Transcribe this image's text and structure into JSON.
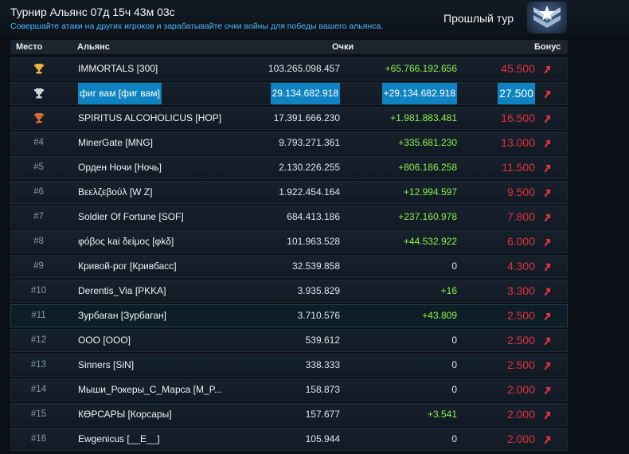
{
  "header": {
    "title": "Турнир Альянс 07д 15ч 43м 03с",
    "subtitle": "Совершайте атаки на других игроков и зарабатывайте очки войны для победы вашего альянса.",
    "prev_round": "Прошлый тур",
    "emblem_icon": "alliance-rank-emblem-icon"
  },
  "columns": {
    "place": "Место",
    "alliance": "Альянс",
    "points": "Очки",
    "bonus": "Бонус"
  },
  "colors": {
    "accent_blue": "#4fb7ff",
    "gain_green": "#8ef24c",
    "bonus_red": "#e0323f",
    "selection": "#0f83c1"
  },
  "rows": [
    {
      "rank": "",
      "trophy": "gold",
      "name": "IMMORTALS [300]",
      "score": "103.265.098.457",
      "gain": "+65.766.192.656",
      "bonus": "45.500"
    },
    {
      "rank": "",
      "trophy": "silver",
      "name": "фиг вам [фиг вам]",
      "score": "29.134.682.918",
      "gain": "+29.134.682.918",
      "bonus": "27.500",
      "selected": true
    },
    {
      "rank": "",
      "trophy": "bronze",
      "name": "SPIRITUS ALCOHOLICUS [НОР]",
      "score": "17.391.666.230",
      "gain": "+1.981.883.481",
      "bonus": "16.500"
    },
    {
      "rank": "#4",
      "name": "MinerGate [MNG]",
      "score": "9.793.271.361",
      "gain": "+335.681.230",
      "bonus": "13.000"
    },
    {
      "rank": "#5",
      "name": "Орден Ночи [Ночь]",
      "score": "2.130.226.255",
      "gain": "+806.186.258",
      "bonus": "11.500"
    },
    {
      "rank": "#6",
      "name": "Βεελζεβούλ [W Z]",
      "score": "1.922.454.164",
      "gain": "+12.994.597",
      "bonus": "9.500"
    },
    {
      "rank": "#7",
      "name": "Soldier Of Fortune [SOF]",
      "score": "684.413.186",
      "gain": "+237.160.978",
      "bonus": "7.800"
    },
    {
      "rank": "#8",
      "name": "φόβος kai δείμος [φkδ]",
      "score": "101.963.528",
      "gain": "+44.532.922",
      "bonus": "6.000"
    },
    {
      "rank": "#9",
      "name": "Кривой-рог [Кривбасс]",
      "score": "32.539.858",
      "gain": "0",
      "bonus": "4.300"
    },
    {
      "rank": "#10",
      "name": "Derentis_Via [PKKA]",
      "score": "3.935.829",
      "gain": "+16",
      "bonus": "3.300"
    },
    {
      "rank": "#11",
      "name": "Зурбаган [Зурбаган]",
      "score": "3.710.576",
      "gain": "+43.809",
      "bonus": "2.500",
      "highlight": true
    },
    {
      "rank": "#12",
      "name": "ООО [ООО]",
      "score": "539.612",
      "gain": "0",
      "bonus": "2.500"
    },
    {
      "rank": "#13",
      "name": "Sinners [SiN]",
      "score": "338.333",
      "gain": "0",
      "bonus": "2.500"
    },
    {
      "rank": "#14",
      "name": "Мыши_Рокеры_С_Марса [M_P...",
      "score": "158.873",
      "gain": "0",
      "bonus": "2.000"
    },
    {
      "rank": "#15",
      "name": "КӨРСАРЫ [Корсары]",
      "score": "157.677",
      "gain": "+3.541",
      "bonus": "2.000"
    },
    {
      "rank": "#16",
      "name": "Ewgenicus [__E__]",
      "score": "105.944",
      "gain": "0",
      "bonus": "2.000"
    }
  ]
}
